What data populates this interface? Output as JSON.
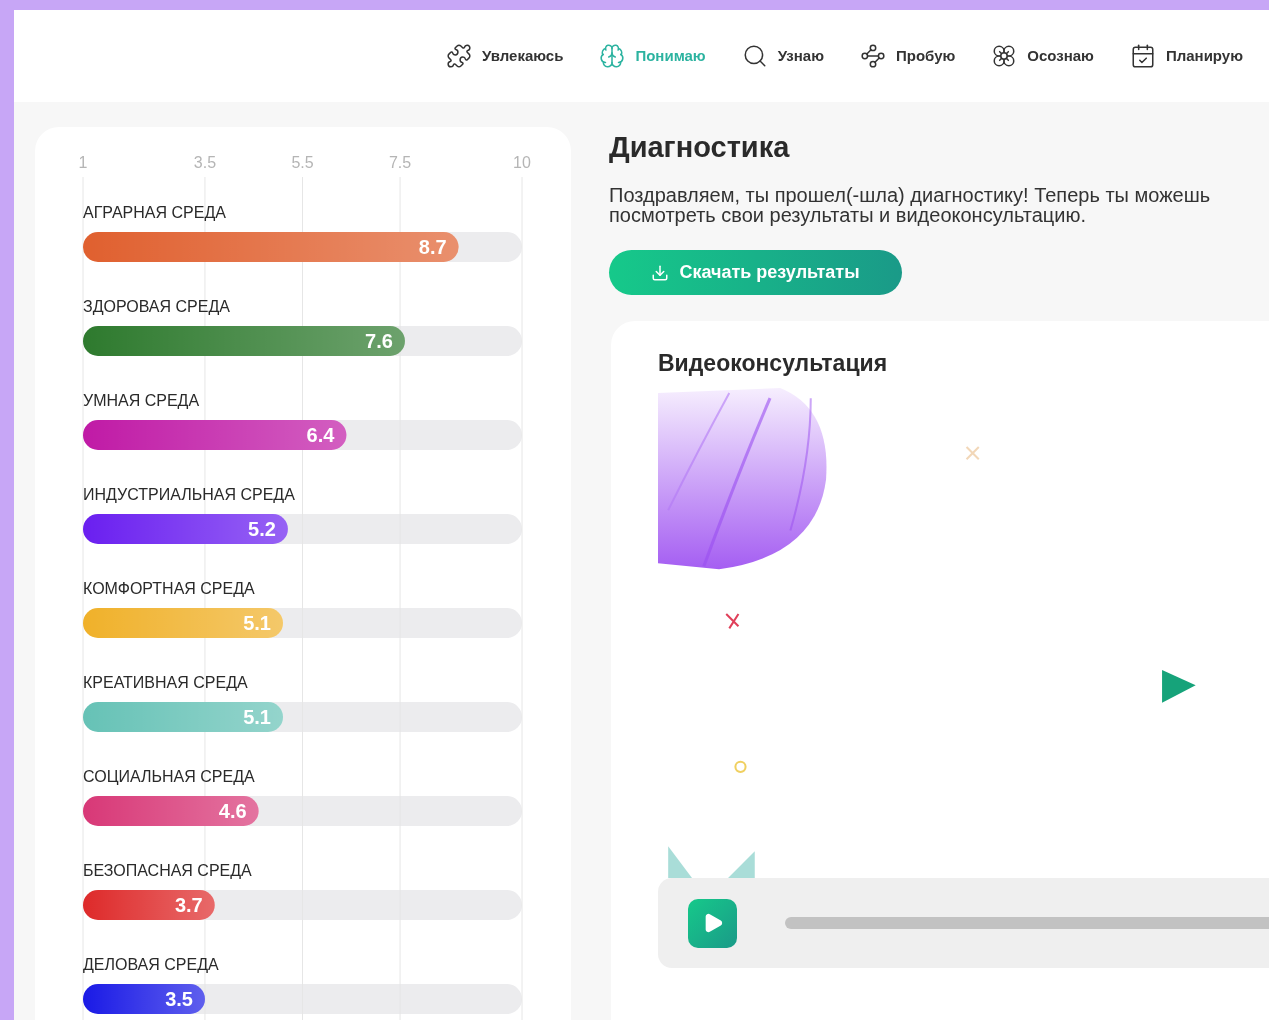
{
  "nav": [
    {
      "label": "Увлекаюсь",
      "selected": false
    },
    {
      "label": "Понимаю",
      "selected": true
    },
    {
      "label": "Узнаю",
      "selected": false
    },
    {
      "label": "Пробую",
      "selected": false
    },
    {
      "label": "Осознаю",
      "selected": false
    },
    {
      "label": "Планирую",
      "selected": false
    }
  ],
  "results": {
    "chart_data": {
      "type": "bar",
      "orientation": "horizontal",
      "categories": [
        "АГРАРНАЯ СРЕДА",
        "ЗДОРОВАЯ СРЕДА",
        "УМНАЯ СРЕДА",
        "ИНДУСТРИАЛЬНАЯ СРЕДА",
        "КОМФОРТНАЯ СРЕДА",
        "КРЕАТИВНАЯ СРЕДА",
        "СОЦИАЛЬНАЯ СРЕДА",
        "БЕЗОПАСНАЯ СРЕДА",
        "ДЕЛОВАЯ СРЕДА"
      ],
      "series": [
        {
          "colors": [
            "#e0602f",
            "#2e7a2e",
            "#c01aa6",
            "#6a1ff0",
            "#f0b12a",
            "#66c2b6",
            "#d83877",
            "#de2a2a",
            "#1a1ae6"
          ],
          "values": [
            8.7,
            7.6,
            6.4,
            5.2,
            5.1,
            5.1,
            4.6,
            3.7,
            3.5
          ]
        }
      ],
      "xlim": [
        1,
        10
      ],
      "xticks": [
        1,
        3.5,
        5.5,
        7.5,
        10
      ],
      "grid": true,
      "data_labels": true
    }
  },
  "diagnostics": {
    "title": "Диагностика",
    "message": "Поздравляем, ты прошел(-шла) диагностику! Теперь ты можешь посмотреть свои результаты и видеоконсультацию.",
    "download_button": "Скачать результаты"
  },
  "video": {
    "title": "Видеоконсультация"
  }
}
